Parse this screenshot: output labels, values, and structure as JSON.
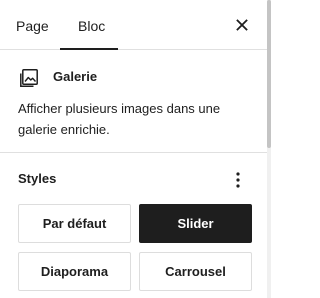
{
  "tabs": [
    {
      "label": "Page",
      "active": false
    },
    {
      "label": "Bloc",
      "active": true
    }
  ],
  "header": {
    "close_icon": "close-icon"
  },
  "block": {
    "icon": "gallery-icon",
    "title": "Galerie",
    "description": "Afficher plusieurs images dans une galerie enrichie."
  },
  "styles": {
    "title": "Styles",
    "more_icon": "more-vertical-icon",
    "options": [
      {
        "label": "Par défaut",
        "selected": false
      },
      {
        "label": "Slider",
        "selected": true
      },
      {
        "label": "Diaporama",
        "selected": false
      },
      {
        "label": "Carrousel",
        "selected": false
      }
    ]
  },
  "colors": {
    "text": "#1e1e1e",
    "selected_bg": "#1e1e1e",
    "selected_text": "#ffffff",
    "border": "#dddddd",
    "divider": "#e0e0e0"
  }
}
